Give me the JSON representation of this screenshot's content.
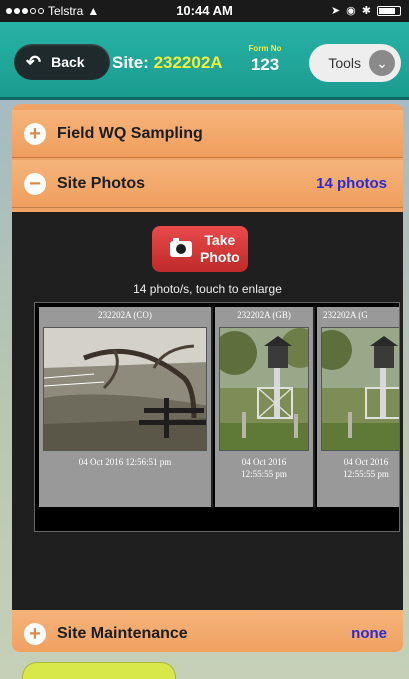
{
  "status_bar": {
    "carrier": "Telstra",
    "time": "10:44 AM"
  },
  "header": {
    "back_label": "Back",
    "site_prefix": "Site: ",
    "site_number": "232202A",
    "form_label": "Form No",
    "form_number": "123",
    "tools_label": "Tools"
  },
  "sections": {
    "field_wq": {
      "label": "Field WQ Sampling"
    },
    "site_photos": {
      "label": "Site Photos",
      "count": "14 photos"
    },
    "site_maintenance": {
      "label": "Site Maintenance",
      "count": "none"
    }
  },
  "photos": {
    "take_photo_line1": "Take",
    "take_photo_line2": "Photo",
    "hint": "14 photo/s, touch to enlarge",
    "items": [
      {
        "title": "232202A (CO)",
        "date": "04 Oct 2016 12:56:51 pm"
      },
      {
        "title": "232202A (GB)",
        "date_line1": "04 Oct 2016",
        "date_line2": "12:55:55 pm"
      },
      {
        "title": "232202A (G",
        "date_line1": "04 Oct 2016",
        "date_line2": "12:55:55 pm"
      }
    ]
  },
  "colors": {
    "header_teal": "#1b9c8f",
    "site_yellow": "#f3ee3b",
    "section_orange": "#f09e5e",
    "count_blue": "#2a2ad6",
    "take_photo_red": "#c02a2a"
  }
}
